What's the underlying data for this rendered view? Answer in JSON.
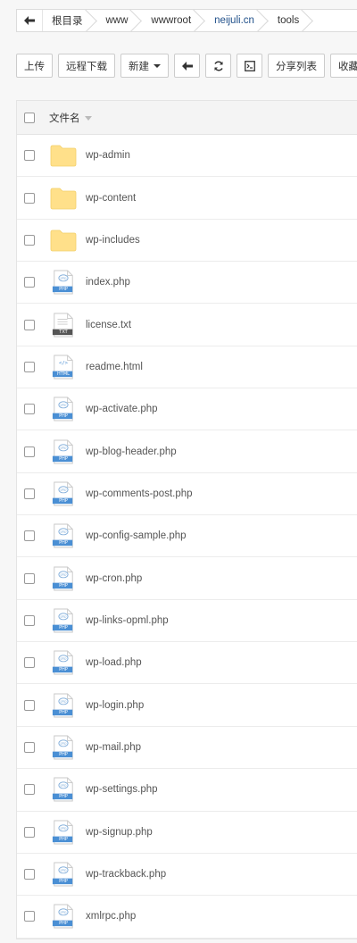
{
  "breadcrumb": {
    "items": [
      "根目录",
      "www",
      "wwwroot",
      "neijuli.cn",
      "tools"
    ]
  },
  "toolbar": {
    "upload": "上传",
    "remote_download": "远程下载",
    "new": "新建",
    "share_list": "分享列表",
    "favorites": "收藏"
  },
  "table": {
    "header_name": "文件名",
    "files": [
      {
        "name": "wp-admin",
        "type": "folder"
      },
      {
        "name": "wp-content",
        "type": "folder"
      },
      {
        "name": "wp-includes",
        "type": "folder"
      },
      {
        "name": "index.php",
        "type": "php"
      },
      {
        "name": "license.txt",
        "type": "txt"
      },
      {
        "name": "readme.html",
        "type": "html"
      },
      {
        "name": "wp-activate.php",
        "type": "php"
      },
      {
        "name": "wp-blog-header.php",
        "type": "php"
      },
      {
        "name": "wp-comments-post.php",
        "type": "php"
      },
      {
        "name": "wp-config-sample.php",
        "type": "php"
      },
      {
        "name": "wp-cron.php",
        "type": "php"
      },
      {
        "name": "wp-links-opml.php",
        "type": "php"
      },
      {
        "name": "wp-load.php",
        "type": "php"
      },
      {
        "name": "wp-login.php",
        "type": "php"
      },
      {
        "name": "wp-mail.php",
        "type": "php"
      },
      {
        "name": "wp-settings.php",
        "type": "php"
      },
      {
        "name": "wp-signup.php",
        "type": "php"
      },
      {
        "name": "wp-trackback.php",
        "type": "php"
      },
      {
        "name": "xmlrpc.php",
        "type": "php"
      }
    ]
  },
  "icon_labels": {
    "php": "PHP",
    "txt": "TXT",
    "html": "HTML"
  },
  "colors": {
    "accent": "#20a53a",
    "folder": "#ffe08a",
    "php_badge": "#4a8fd4",
    "txt_badge": "#555555"
  }
}
